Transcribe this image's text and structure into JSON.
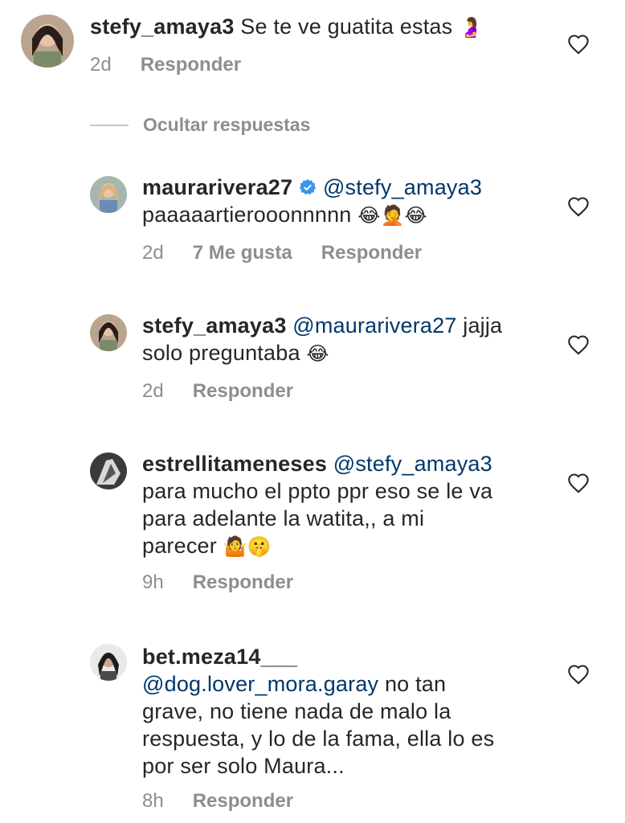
{
  "comments": [
    {
      "username": "stefy_amaya3",
      "verified": false,
      "mention": "",
      "text": "Se te ve guatita estas",
      "emoji": "🤰",
      "time": "2d",
      "likes": "",
      "reply_label": "Responder"
    },
    {
      "username": "maurarivera27",
      "verified": true,
      "mention": "@stefy_amaya3",
      "text": "paaaaartierooonnnnn",
      "emoji": "😂🤦😂",
      "time": "2d",
      "likes": "7 Me gusta",
      "reply_label": "Responder"
    },
    {
      "username": "stefy_amaya3",
      "verified": false,
      "mention": "@maurarivera27",
      "text_line1": "jajja",
      "text_line2": "solo preguntaba",
      "emoji": "😂",
      "time": "2d",
      "likes": "",
      "reply_label": "Responder"
    },
    {
      "username": "estrellitameneses",
      "verified": false,
      "mention": "@stefy_amaya3",
      "text_line1": "para mucho el ppto ppr eso se le va",
      "text_line2": "para adelante la watita,, a mi",
      "text_line3": "parecer",
      "emoji": "🤷🤫",
      "time": "9h",
      "likes": "",
      "reply_label": "Responder"
    },
    {
      "username": "bet.meza14___",
      "verified": false,
      "mention": "@dog.lover_mora.garay",
      "text_line1": "no tan",
      "text_line2": "grave, no tiene nada de malo la",
      "text_line3": "respuesta, y lo de la fama, ella lo es",
      "text_line4": "por ser solo Maura...",
      "time": "8h",
      "likes": "",
      "reply_label": "Responder"
    }
  ],
  "hide_replies_label": "Ocultar respuestas",
  "colors": {
    "text": "#262626",
    "secondary": "#8e8e8e",
    "mention": "#00376b",
    "verified": "#3897f0"
  }
}
